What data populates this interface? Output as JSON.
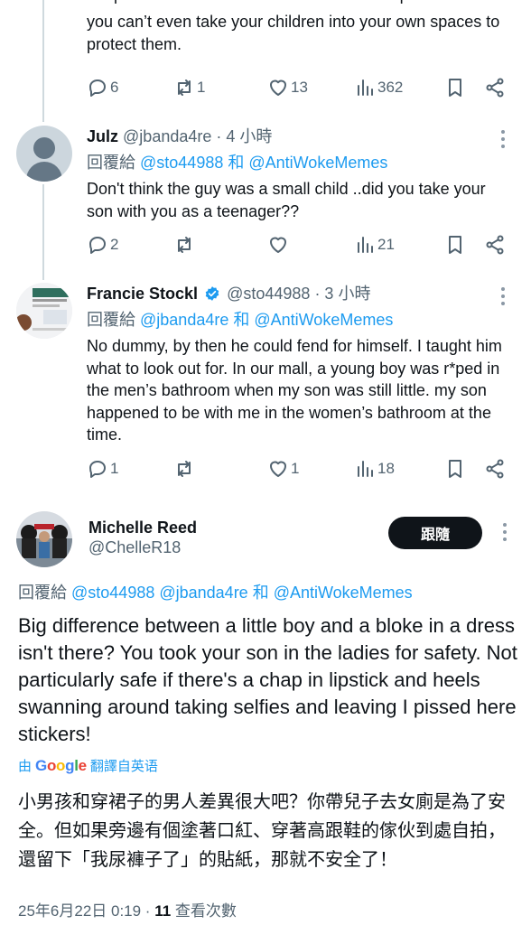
{
  "tweets": [
    {
      "text_tail": "you can’t even take your children into your own spaces to protect them.",
      "replies": "6",
      "retweets": "1",
      "likes": "13",
      "views": "362"
    },
    {
      "name": "Julz",
      "handle": "@jbanda4re",
      "time": "· 4 小時",
      "reply_prefix": "回覆給",
      "reply_mentions": "@sto44988 和 @AntiWokeMemes",
      "text": "Don't think the guy was a  small child ..did you take your son with you as a teenager??",
      "replies": "2",
      "retweets": "",
      "likes": "",
      "views": "21"
    },
    {
      "name": "Francie Stockl",
      "handle": "@sto44988",
      "time": "· 3 小時",
      "reply_prefix": "回覆給",
      "reply_mentions": "@jbanda4re 和 @AntiWokeMemes",
      "text": "No dummy, by then he could fend for himself. I taught him what to look out for. In our mall, a young boy was r*ped in the men’s bathroom when my son was still little. my son happened to be with me in the women’s bathroom at the time.",
      "replies": "1",
      "retweets": "",
      "likes": "1",
      "views": "18"
    }
  ],
  "main": {
    "name": "Michelle Reed",
    "handle": "@ChelleR18",
    "follow_label": "跟隨",
    "reply_prefix": "回覆給",
    "reply_mentions": "@sto44988 @jbanda4re 和 @AntiWokeMemes",
    "text": "Big difference between a little boy and a bloke in a dress isn't there? You took your son in the ladies for safety. Not particularly safe if there's a chap in lipstick and heels swanning around taking selfies and leaving I pissed here stickers!",
    "translate_by": "由",
    "translate_brand": "Google",
    "translate_label": "翻譯自英语",
    "translated": "小男孩和穿裙子的男人差異很大吧？你帶兒子去女廁是為了安全。但如果旁邊有個塗著口紅、穿著高跟鞋的傢伙到處自拍，還留下「我尿褲子了」的貼紙，那就不安全了！",
    "timestamp": "25年6月22日 0:19 · ",
    "views_count": "11",
    "views_label": " 查看次數"
  },
  "colors": {
    "accent": "#1d9bf0",
    "verified": "#1d9bf0",
    "muted": "#536471"
  }
}
